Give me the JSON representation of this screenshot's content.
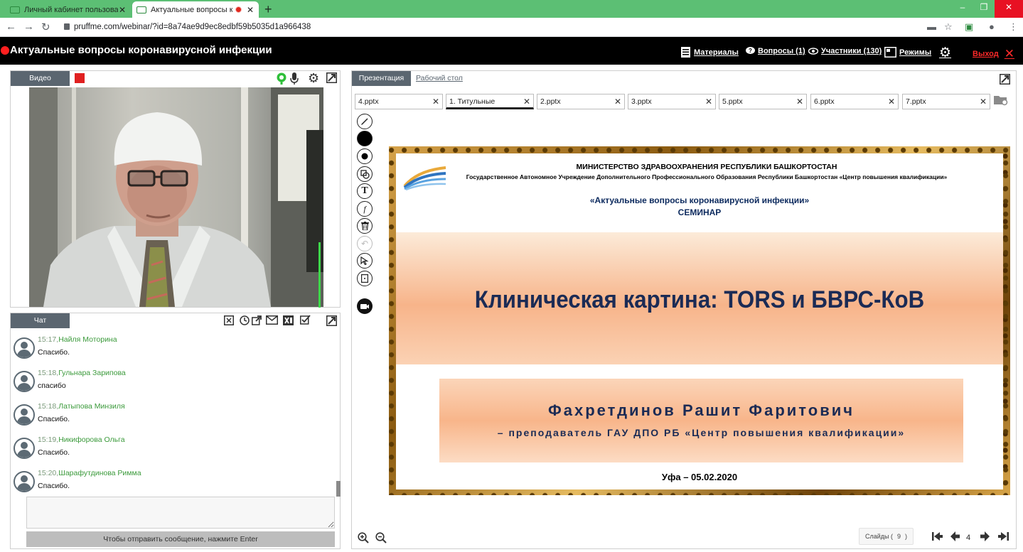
{
  "browser": {
    "tabs": [
      {
        "title": "Личный кабинет пользователя",
        "active": false
      },
      {
        "title": "Актуальные вопросы корон",
        "active": true
      }
    ],
    "url": "pruffme.com/webinar/?id=8a74ae9d9ec8edbf59b5035d1a966438"
  },
  "header": {
    "title": "Актуальные вопросы коронавирусной инфекции",
    "menu": {
      "materials": "Материалы",
      "questions": "Вопросы (1)",
      "participants": "Участники (130)",
      "modes": "Режимы",
      "exit": "Выход"
    }
  },
  "video": {
    "tab_label": "Видео"
  },
  "chat": {
    "tab_label": "Чат",
    "messages": [
      {
        "time": "15:17,",
        "author": "Найля Моторина",
        "text": "Спасибо."
      },
      {
        "time": "15:18,",
        "author": "Гульнара Зарипова",
        "text": "спасибо"
      },
      {
        "time": "15:18,",
        "author": "Латыпова Минзиля",
        "text": "Спасибо."
      },
      {
        "time": "15:19,",
        "author": "Никифорова Ольга",
        "text": "Спасибо."
      },
      {
        "time": "15:20,",
        "author": "Шарафутдинова Римма",
        "text": "Спасибо."
      }
    ],
    "input_value": "",
    "send_hint": "Чтобы отправить сообщение, нажмите Enter"
  },
  "presentation": {
    "tabs": {
      "presentation": "Презентация",
      "desktop": "Рабочий стол"
    },
    "files": [
      "4.pptx",
      "1. Титульные",
      "2.pptx",
      "3.pptx",
      "5.pptx",
      "6.pptx",
      "7.pptx"
    ],
    "selected_file_index": 1,
    "slide": {
      "ministry": "МИНИСТЕРСТВО ЗДРАВООХРАНЕНИЯ РЕСПУБЛИКИ БАШКОРТОСТАН",
      "institution": "Государственное Автономное Учреждение Дополнительного Профессионального Образования Республики Башкортостан «Центр повышения квалификации»",
      "seminar_title": "«Актуальные вопросы коронавирусной инфекции»",
      "seminar_sub": "СЕМИНАР",
      "title": "Клиническая картина: TORS и БВРС-КоВ",
      "author": "Фахретдинов Рашит Фаритович",
      "author_role": "– преподаватель ГАУ ДПО РБ «Центр повышения квалификации»",
      "footer": "Уфа – 05.02.2020"
    },
    "slides_label": "Слайды (",
    "slides_total": "9",
    "slides_close": ")",
    "current_page": "4"
  },
  "colors": {
    "header_bg": "#000000",
    "accent_red": "#ff1f1f",
    "panel_tab": "#5b6670",
    "chat_author": "#3b9a3b",
    "tabstrip": "#5cbf74",
    "slide_navy": "#1b2b55"
  },
  "icons": {
    "tools": [
      "pen-icon",
      "color-icon",
      "brush-size-icon",
      "shapes-icon",
      "text-icon",
      "formula-icon",
      "trash-icon",
      "undo-icon",
      "pointer-icon",
      "page-icon",
      "camera-icon"
    ]
  }
}
